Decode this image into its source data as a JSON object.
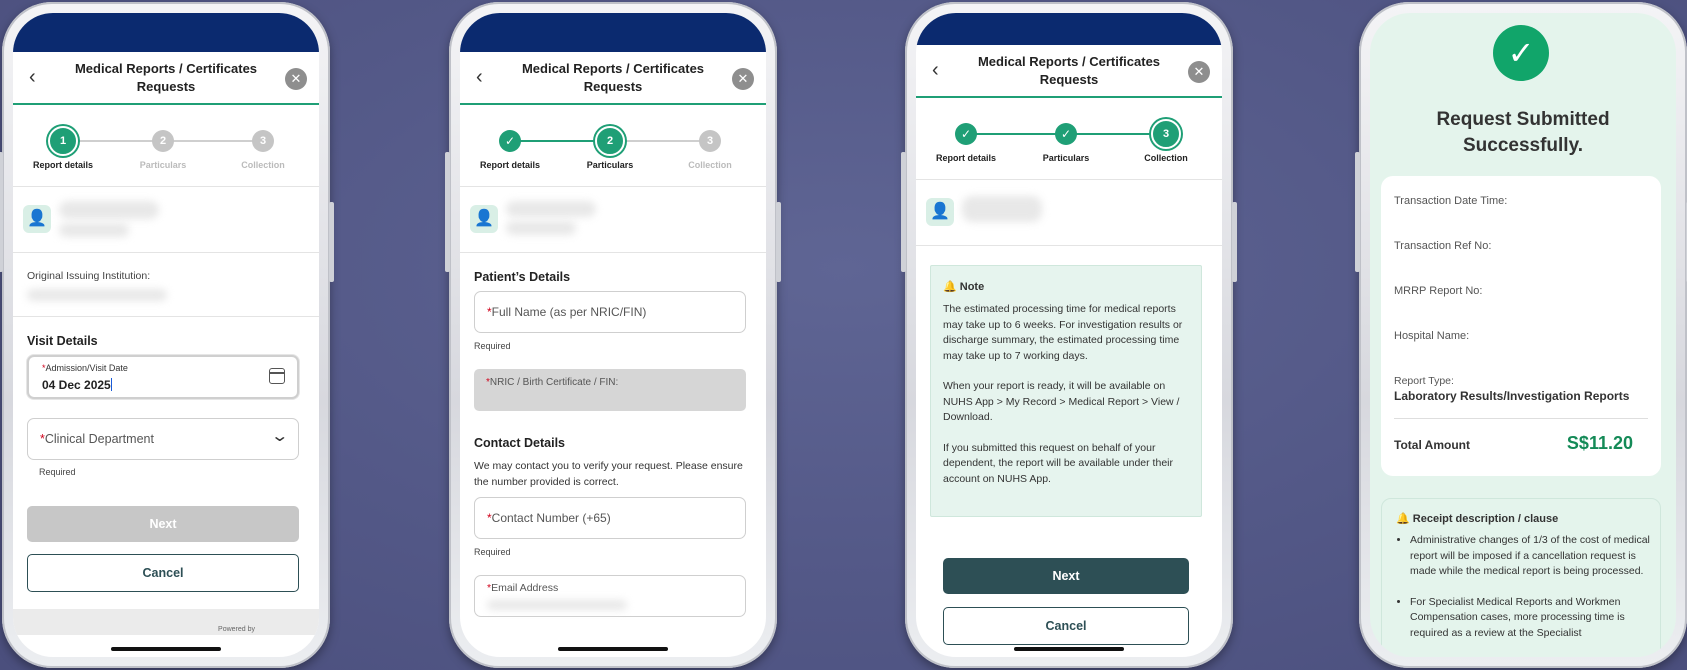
{
  "colors": {
    "accent": "#1f9f76",
    "navy": "#0b2a6f",
    "dark_button": "#2d4f55",
    "disabled": "#c7c7c7"
  },
  "header_title": "Medical Reports / Certificates Requests",
  "steps": [
    {
      "num": "1",
      "label": "Report details"
    },
    {
      "num": "2",
      "label": "Particulars"
    },
    {
      "num": "3",
      "label": "Collection"
    }
  ],
  "phone1": {
    "institution_label": "Original Issuing Institution:",
    "visit_title": "Visit Details",
    "date_label": "Admission/Visit Date",
    "date_value": "04 Dec 2025",
    "department_placeholder": "Clinical Department",
    "required": "Required",
    "next": "Next",
    "cancel": "Cancel",
    "powered_by": "Powered by"
  },
  "phone2": {
    "patient_title": "Patient’s Details",
    "fullname_placeholder": "Full Name (as per NRIC/FIN)",
    "required": "Required",
    "nric_label": "NRIC / Birth Certificate / FIN:",
    "contact_title": "Contact Details",
    "contact_desc": "We may contact you to verify your request. Please ensure the number provided is correct.",
    "contact_placeholder": "Contact Number (+65)",
    "email_label": "Email Address"
  },
  "phone3": {
    "note_title": "Note",
    "note_p1": "The estimated processing time for medical reports may take up to 6 weeks. For investigation results or discharge summary, the estimated processing time may take up to 7 working days.",
    "note_p2": "When your report is ready, it will be available on NUHS App > My Record > Medical Report > View / Download.",
    "note_p3": "If you submitted this request on behalf of your dependent, the report will be available under their account on NUHS App.",
    "next": "Next",
    "cancel": "Cancel"
  },
  "phone4": {
    "title": "Request Submitted Successfully.",
    "labels": [
      "Transaction Date Time:",
      "Transaction Ref No:",
      "MRRP Report No:",
      "Hospital Name:"
    ],
    "report_type_label": "Report Type:",
    "report_type_value": "Laboratory Results/Investigation Reports",
    "total_label": "Total Amount",
    "total_value": "S$11.20",
    "receipt_title": "Receipt description / clause",
    "bullet1": "Administrative changes of 1/3 of the cost of medical report will be imposed if a cancellation request is made while the medical report is being processed.",
    "bullet2": "For Specialist Medical Reports and Workmen Compensation cases, more processing time is required as a review at the Specialist"
  }
}
